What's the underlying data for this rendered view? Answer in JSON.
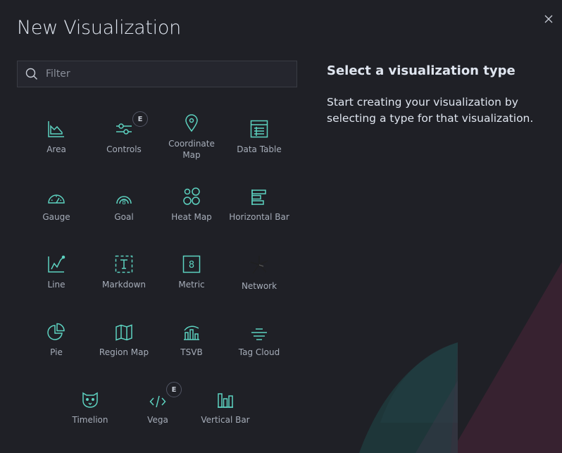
{
  "modal": {
    "title": "New Visualization"
  },
  "search": {
    "placeholder": "Filter",
    "value": ""
  },
  "side": {
    "title": "Select a visualization type",
    "description": "Start creating your visualization by selecting a type for that visualization."
  },
  "colors": {
    "accent": "#5dd3c1",
    "background": "#1f2026",
    "text": "#dfe5ef",
    "muted": "#a6adb9"
  },
  "visualizations": [
    {
      "label": "Area",
      "icon": "area-chart-icon"
    },
    {
      "label": "Controls",
      "icon": "controls-icon",
      "badge": "E"
    },
    {
      "label": "Coordinate Map",
      "icon": "map-pin-icon"
    },
    {
      "label": "Data Table",
      "icon": "table-icon"
    },
    {
      "label": "Gauge",
      "icon": "gauge-icon"
    },
    {
      "label": "Goal",
      "icon": "goal-icon"
    },
    {
      "label": "Heat Map",
      "icon": "heat-map-icon"
    },
    {
      "label": "Horizontal Bar",
      "icon": "horizontal-bar-icon"
    },
    {
      "label": "Line",
      "icon": "line-chart-icon"
    },
    {
      "label": "Markdown",
      "icon": "markdown-icon"
    },
    {
      "label": "Metric",
      "icon": "metric-icon"
    },
    {
      "label": "Network",
      "icon": "network-icon"
    },
    {
      "label": "Pie",
      "icon": "pie-chart-icon"
    },
    {
      "label": "Region Map",
      "icon": "region-map-icon"
    },
    {
      "label": "TSVB",
      "icon": "tsvb-icon"
    },
    {
      "label": "Tag Cloud",
      "icon": "tag-cloud-icon"
    },
    {
      "label": "Timelion",
      "icon": "timelion-icon"
    },
    {
      "label": "Vega",
      "icon": "vega-icon",
      "badge": "E"
    },
    {
      "label": "Vertical Bar",
      "icon": "vertical-bar-icon"
    }
  ]
}
